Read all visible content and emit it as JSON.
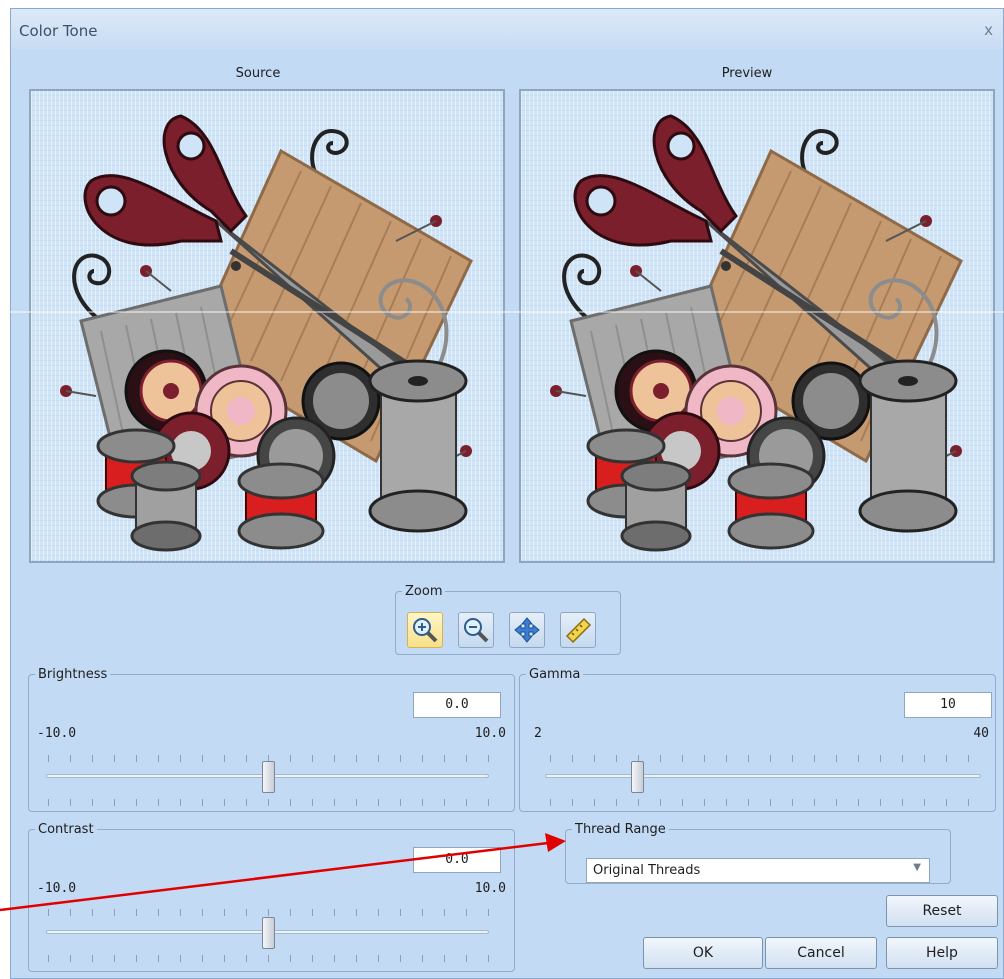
{
  "window": {
    "title": "Color Tone",
    "close_glyph": "x"
  },
  "panes": {
    "source_label": "Source",
    "preview_label": "Preview"
  },
  "zoom": {
    "label": "Zoom",
    "buttons": [
      {
        "icon": "zoom-in-icon",
        "active": true
      },
      {
        "icon": "zoom-out-icon",
        "active": false
      },
      {
        "icon": "fit-to-window-icon",
        "active": false
      },
      {
        "icon": "ruler-icon",
        "active": false
      }
    ]
  },
  "brightness": {
    "label": "Brightness",
    "value": "0.0",
    "min": "-10.0",
    "max": "10.0",
    "level": 0.5
  },
  "gamma": {
    "label": "Gamma",
    "value": "10",
    "min": "2",
    "max": "40",
    "level": 0.21
  },
  "contrast": {
    "label": "Contrast",
    "value": "0.0",
    "min": "-10.0",
    "max": "10.0",
    "level": 0.5
  },
  "thread_range": {
    "label": "Thread Range",
    "selected": "Original Threads"
  },
  "buttons": {
    "reset": "Reset",
    "ok": "OK",
    "cancel": "Cancel",
    "help": "Help"
  },
  "colors": {
    "dialog_bg": "#c3daf4",
    "annotation_arrow": "#e00000",
    "thread_dark_red": "#7a1f2b",
    "thread_tan": "#c69a70",
    "thread_gray": "#8c8c8c",
    "thread_red": "#d81e1e"
  }
}
